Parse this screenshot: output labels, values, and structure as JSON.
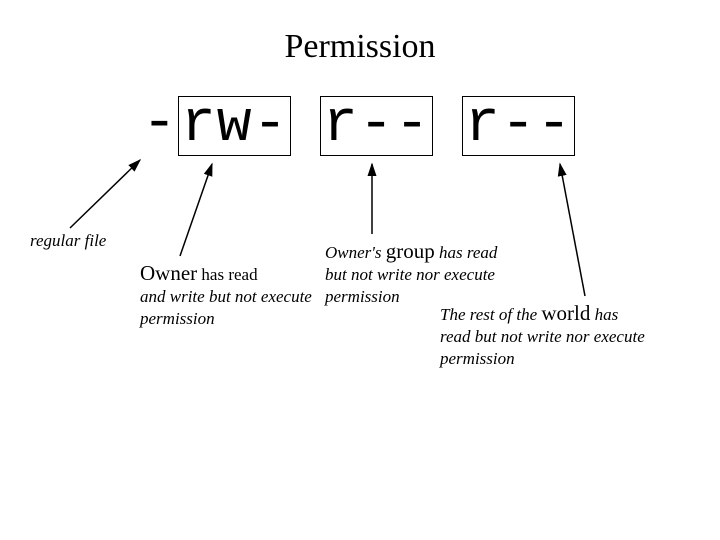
{
  "title": "Permission",
  "permission": {
    "type_char": "-",
    "owner": "rw-",
    "group": "r--",
    "world": "r--"
  },
  "labels": {
    "file": "regular file",
    "owner_word": "Owner",
    "owner_rest1": " has read",
    "owner_rest2": "and write but not execute permission",
    "group_pre": "Owner's ",
    "group_word": "group",
    "group_rest1": " has read",
    "group_rest2": "but not write nor execute permission",
    "world_pre": "The rest of the ",
    "world_word": "world",
    "world_rest1": " has",
    "world_rest2": "read but not write nor execute permission"
  }
}
